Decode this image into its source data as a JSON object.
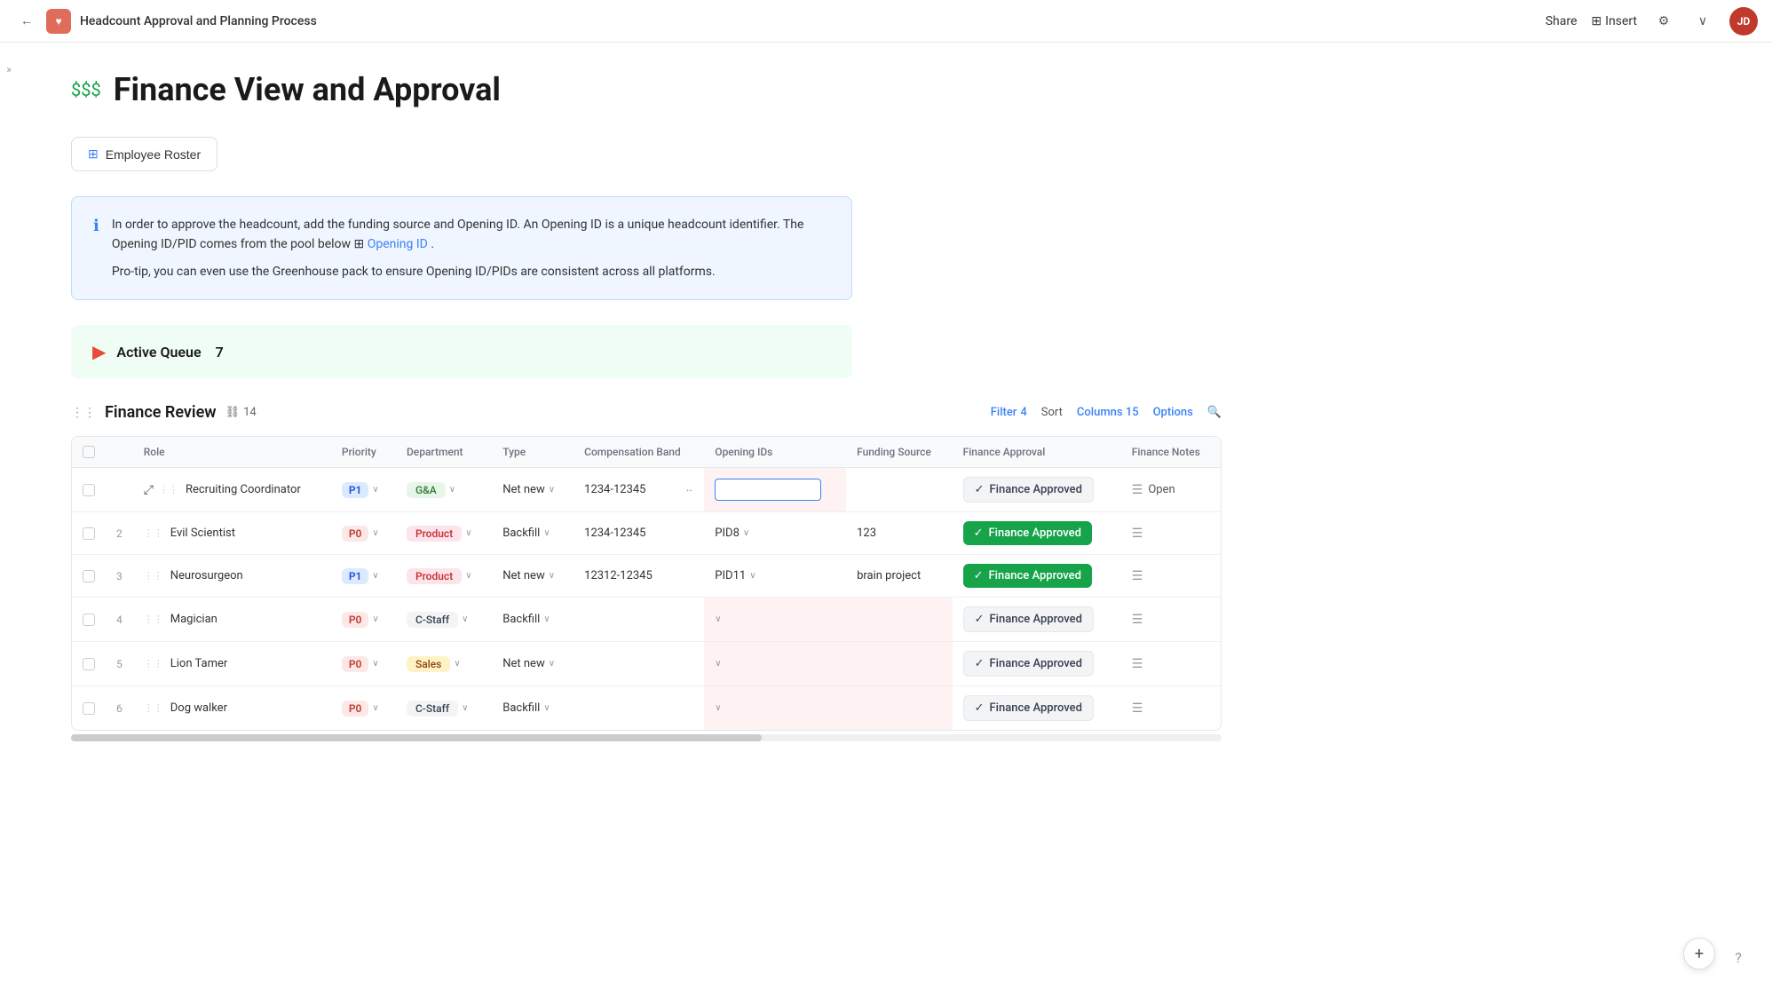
{
  "nav": {
    "back_icon": "←",
    "logo_text": "❤",
    "title": "Headcount Approval and Planning Process",
    "share_label": "Share",
    "insert_label": "Insert",
    "settings_icon": "⚙",
    "chevron_icon": "∨",
    "avatar_text": "JD"
  },
  "sidebar": {
    "toggle_icon": "»"
  },
  "page": {
    "icon": "$$$",
    "title": "Finance View and Approval"
  },
  "employee_roster": {
    "label": "Employee Roster",
    "icon": "👤"
  },
  "info_box": {
    "icon": "ℹ",
    "text1": "In order to approve the headcount, add the funding source and Opening ID. An Opening ID is a unique headcount identifier. The Opening ID/PID comes from the pool below ",
    "link": "Opening ID",
    "link_icon": "⊞",
    "text2": ".",
    "text3": "Pro-tip, you can even use the Greenhouse pack to ensure Opening ID/PIDs are consistent across all platforms."
  },
  "active_queue": {
    "icon": "▶",
    "label": "Active Queue",
    "count": "7"
  },
  "finance_review": {
    "drag_icon": "⋮⋮",
    "title": "Finance Review",
    "link_icon": "⛓",
    "link_count": "14",
    "filter_label": "Filter",
    "filter_count": "4",
    "sort_label": "Sort",
    "columns_label": "Columns",
    "columns_count": "15",
    "options_label": "Options",
    "search_icon": "🔍"
  },
  "table": {
    "columns": [
      {
        "key": "checkbox",
        "label": ""
      },
      {
        "key": "row_num",
        "label": ""
      },
      {
        "key": "role",
        "label": "Role"
      },
      {
        "key": "priority",
        "label": "Priority"
      },
      {
        "key": "department",
        "label": "Department"
      },
      {
        "key": "type",
        "label": "Type"
      },
      {
        "key": "compensation_band",
        "label": "Compensation Band"
      },
      {
        "key": "opening_ids",
        "label": "Opening IDs"
      },
      {
        "key": "funding_source",
        "label": "Funding Source"
      },
      {
        "key": "finance_approval",
        "label": "Finance Approval"
      },
      {
        "key": "finance_notes",
        "label": "Finance Notes"
      }
    ],
    "rows": [
      {
        "num": "",
        "role": "Recruiting Coordinator",
        "priority": "P1",
        "priority_class": "p1",
        "department": "G&A",
        "dept_class": "gna",
        "type": "Net new",
        "compensation_band": "1234-12345",
        "compensation_band_editing": true,
        "opening_ids": "",
        "opening_ids_empty": true,
        "funding_source": "",
        "funding_source_empty": true,
        "finance_approval": "Finance Approved",
        "finance_approval_style": "gray",
        "finance_notes": "Open",
        "highlighted": false,
        "row_editing": true
      },
      {
        "num": "2",
        "role": "Evil Scientist",
        "priority": "P0",
        "priority_class": "p0",
        "department": "Product",
        "dept_class": "product",
        "type": "Backfill",
        "compensation_band": "1234-12345",
        "opening_ids": "PID8",
        "opening_ids_empty": false,
        "funding_source": "123",
        "funding_source_empty": false,
        "finance_approval": "Finance Approved",
        "finance_approval_style": "green",
        "finance_notes": "",
        "highlighted": false
      },
      {
        "num": "3",
        "role": "Neurosurgeon",
        "priority": "P1",
        "priority_class": "p1",
        "department": "Product",
        "dept_class": "product",
        "type": "Net new",
        "compensation_band": "12312-12345",
        "opening_ids": "PID11",
        "opening_ids_empty": false,
        "funding_source": "brain project",
        "funding_source_empty": false,
        "finance_approval": "Finance Approved",
        "finance_approval_style": "green",
        "finance_notes": "",
        "highlighted": false
      },
      {
        "num": "4",
        "role": "Magician",
        "priority": "P0",
        "priority_class": "p0",
        "department": "C-Staff",
        "dept_class": "cstaff",
        "type": "Backfill",
        "compensation_band": "",
        "opening_ids": "",
        "opening_ids_empty": true,
        "funding_source": "",
        "funding_source_empty": true,
        "finance_approval": "Finance Approved",
        "finance_approval_style": "gray",
        "finance_notes": "",
        "highlighted": true
      },
      {
        "num": "5",
        "role": "Lion Tamer",
        "priority": "P0",
        "priority_class": "p0",
        "department": "Sales",
        "dept_class": "sales",
        "type": "Net new",
        "compensation_band": "",
        "opening_ids": "",
        "opening_ids_empty": true,
        "funding_source": "",
        "funding_source_empty": true,
        "finance_approval": "Finance Approved",
        "finance_approval_style": "gray",
        "finance_notes": "",
        "highlighted": true
      },
      {
        "num": "6",
        "role": "Dog walker",
        "priority": "P0",
        "priority_class": "p0",
        "department": "C-Staff",
        "dept_class": "cstaff",
        "type": "Backfill",
        "compensation_band": "",
        "opening_ids": "",
        "opening_ids_empty": true,
        "funding_source": "",
        "funding_source_empty": true,
        "finance_approval": "Finance Approved",
        "finance_approval_style": "gray",
        "finance_notes": "",
        "highlighted": true
      }
    ]
  },
  "add_row_icon": "+",
  "help_icon": "?"
}
